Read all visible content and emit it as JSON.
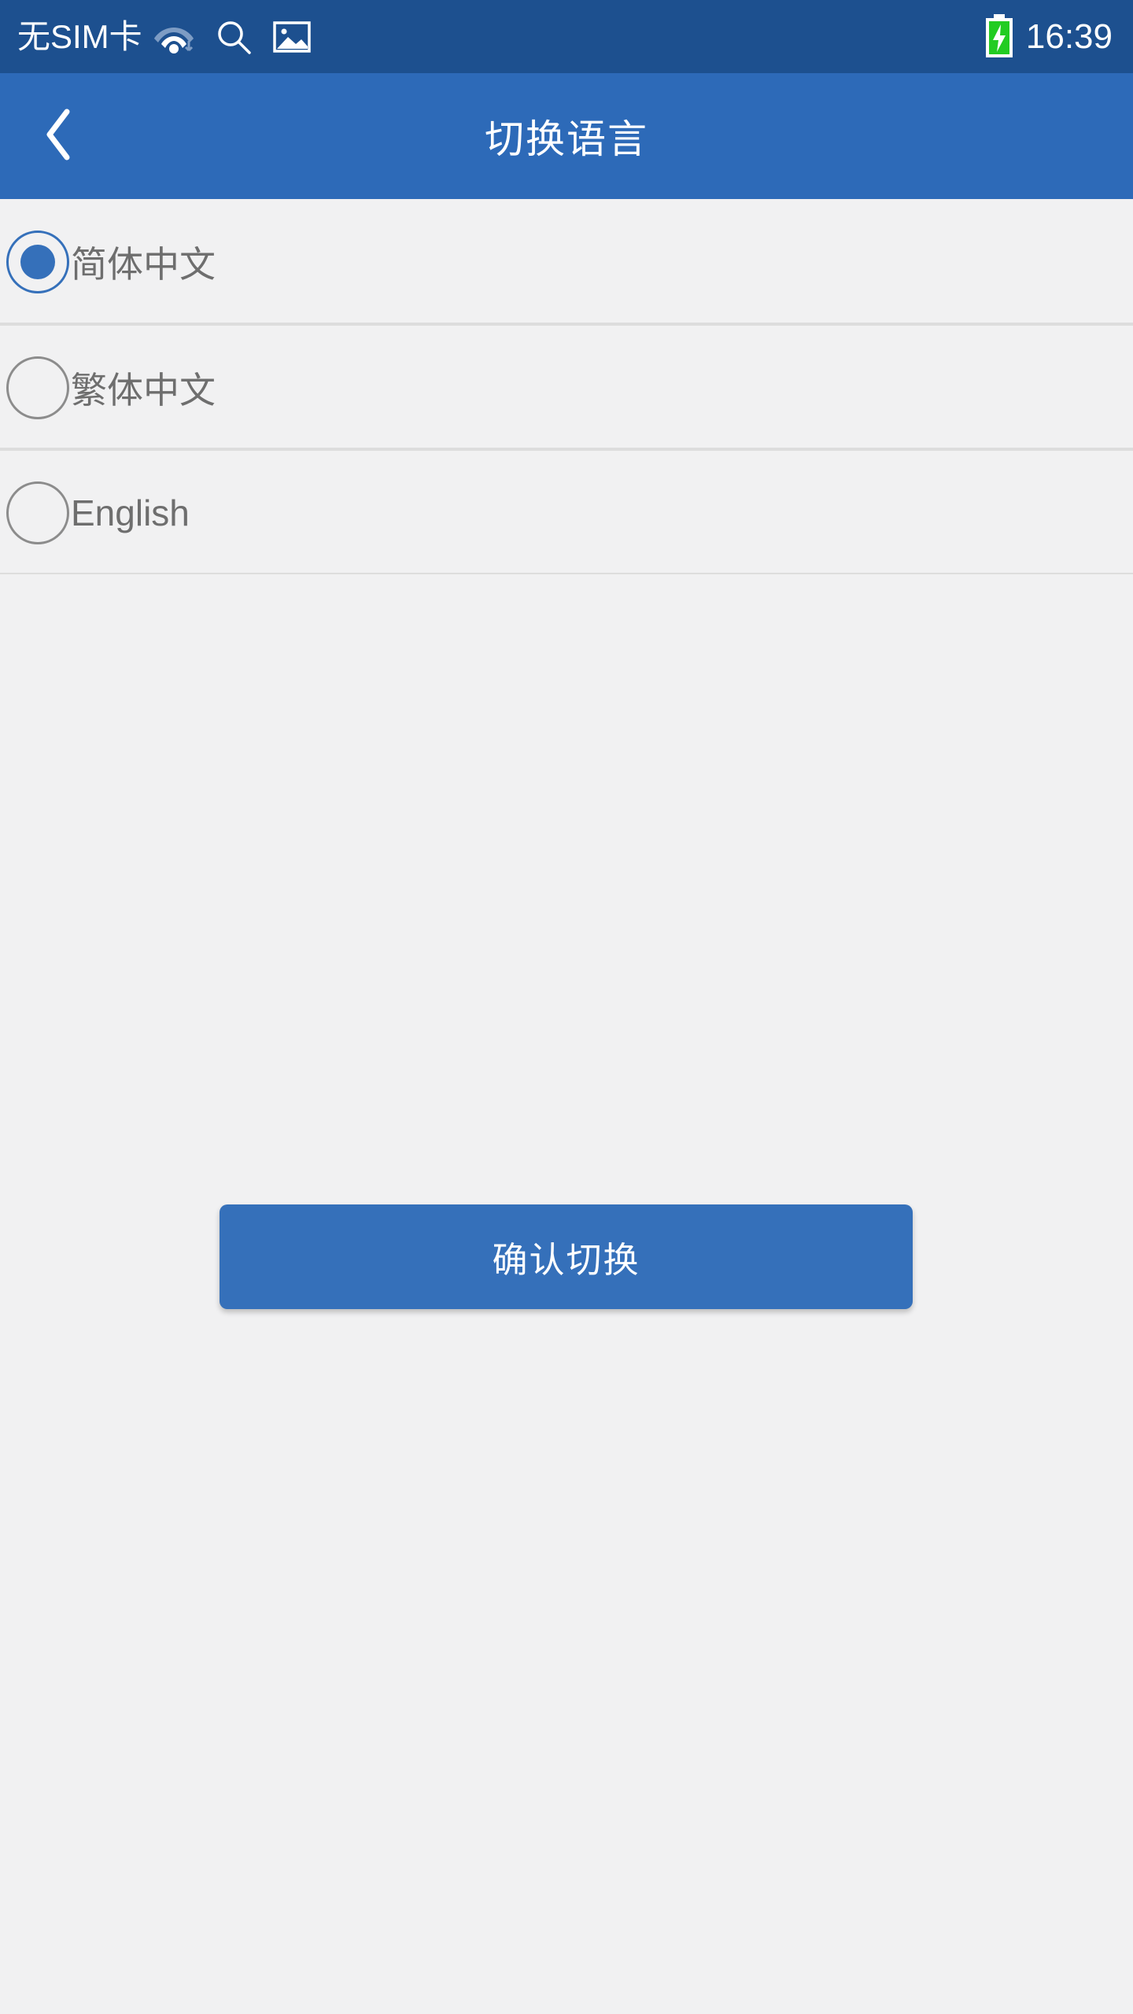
{
  "status_bar": {
    "carrier": "无SIM卡",
    "clock": "16:39",
    "icons": {
      "wifi": "wifi-icon",
      "search": "search-icon",
      "picture": "picture-icon",
      "battery": "battery-charging-icon"
    },
    "background_color": "#1d508f",
    "battery_color": "#22cc22"
  },
  "title_bar": {
    "title": "切换语言",
    "back_icon": "chevron-left-icon",
    "background_color": "#2d6ab8"
  },
  "language_list": {
    "options": [
      {
        "label": "简体中文",
        "selected": true
      },
      {
        "label": "繁体中文",
        "selected": false
      },
      {
        "label": "English",
        "selected": false
      }
    ],
    "selected_color": "#3570ba",
    "unselected_color": "#8c8c8c",
    "label_color": "#6e6e6e",
    "divider_color": "#dddddd"
  },
  "confirm_button": {
    "label": "确认切换",
    "background_color": "#3570ba",
    "text_color": "#ffffff"
  },
  "page": {
    "background_color": "#f1f1f2"
  }
}
